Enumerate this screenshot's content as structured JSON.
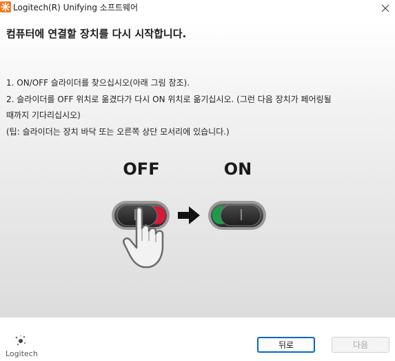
{
  "window": {
    "title": "Logitech(R) Unifying 소프트웨어"
  },
  "heading": "컴퓨터에 연결할 장치를 다시 시작합니다.",
  "instructions": [
    "1. ON/OFF 슬라이더를 찾으십시오(아래 그림 참조).",
    "2. 슬라이더를 OFF 위치로 옮겼다가 다시 ON 위치로 옮기십시오. (그런 다음 장치가 페어링될",
    "때까지 기다리십시오)",
    "(팁: 슬라이더는 장치 바닥 또는 오른쪽 상단 모서리에 있습니다.)"
  ],
  "illustration": {
    "off_label": "OFF",
    "on_label": "ON"
  },
  "footer": {
    "logo_text": "Logitech",
    "back_button": "뒤로",
    "next_button": "다음"
  },
  "colors": {
    "accent": "#0a64c8",
    "off_red": "#d7193a",
    "on_green": "#1f9a4a",
    "app_icon_orange": "#f07a22"
  }
}
